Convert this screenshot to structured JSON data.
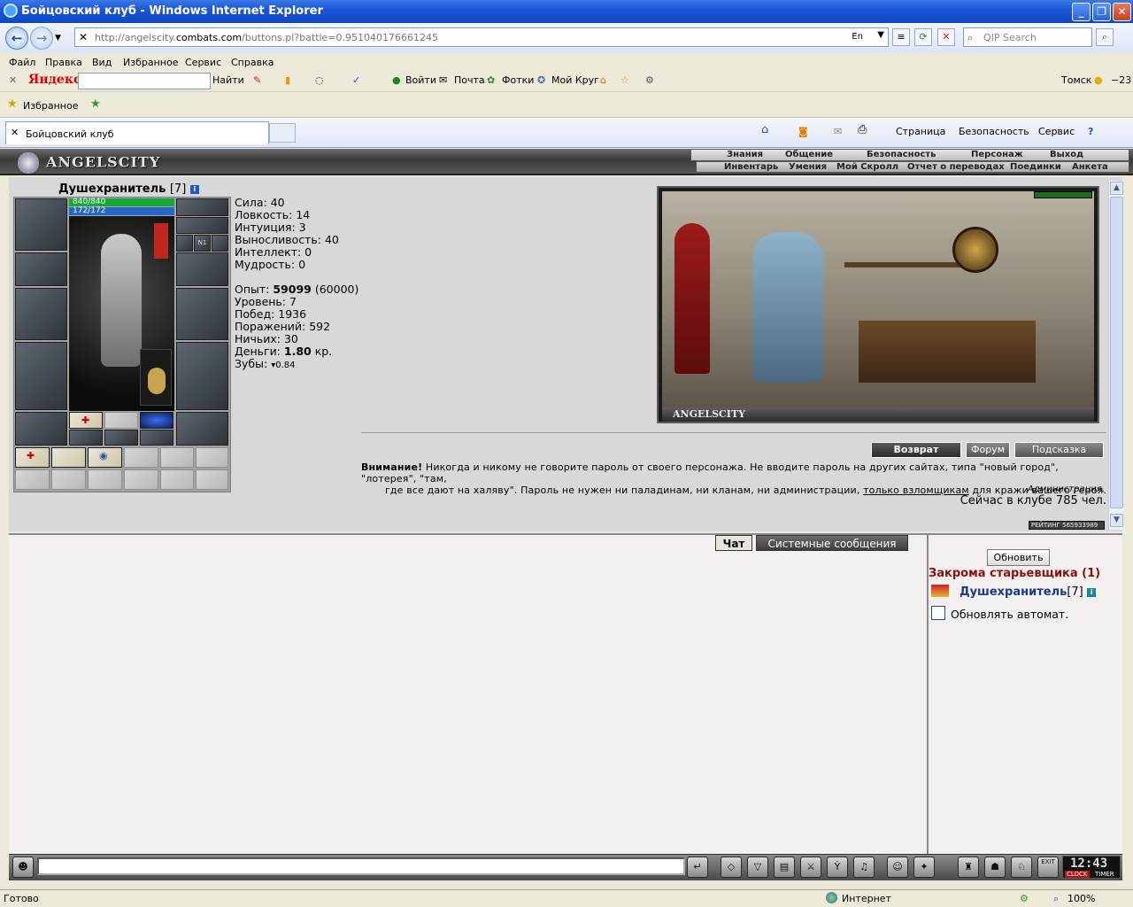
{
  "window": {
    "title": "Бойцовский клуб - Windows Internet Explorer",
    "url_prefix": "http://angelscity.",
    "url_domain": "combats.com",
    "url_suffix": "/buttons.pl?battle=0.951040176661245",
    "search_placeholder": "QIP Search",
    "lang_indicator": "En"
  },
  "menu": [
    "Файл",
    "Правка",
    "Вид",
    "Избранное",
    "Сервис",
    "Справка"
  ],
  "yandex_bar": {
    "brand": "Яндекс",
    "find": "Найти",
    "login": "Войти",
    "mail": "Почта",
    "photos": "Фотки",
    "circle": "Мой Круг",
    "city": "Томск",
    "temp": "−23"
  },
  "favorites_bar": {
    "favorites": "Избранное"
  },
  "tabs": {
    "active": "Бойцовский клуб"
  },
  "command_bar": [
    "Страница",
    "Безопасность",
    "Сервис"
  ],
  "game": {
    "logo": "ANGELSCITY",
    "top_menu": [
      "Знания",
      "Общение",
      "Безопасность",
      "Персонаж",
      "Выход"
    ],
    "sub_menu": [
      "Инвентарь",
      "Умения",
      "Мой Скролл",
      "Отчет о переводах",
      "Поединки",
      "Анкета"
    ],
    "character": {
      "name": "Душехранитель",
      "level": "[7]",
      "hp": "840/840",
      "mana": "172/172",
      "slot_label": "N1"
    },
    "stats": {
      "strength": "Сила: 40",
      "agility": "Ловкость: 14",
      "intuition": "Интуиция: 3",
      "endurance": "Выносливость: 40",
      "intellect": "Интеллект: 0",
      "wisdom": "Мудрость: 0",
      "exp_label": "Опыт: ",
      "exp_value": "59099",
      "exp_next": " (60000)",
      "level": "Уровень: 7",
      "wins": "Побед: 1936",
      "losses": "Поражений: 592",
      "draws": "Ничьих: 30",
      "money_label": "Деньги: ",
      "money_value": "1.80",
      "money_unit": " кр.",
      "teeth_label": "Зубы: ",
      "teeth_value": "0.84"
    },
    "scene_caption": "ANGELSCITY",
    "buttons": {
      "back": "Возврат",
      "forum": "Форум",
      "hint": "Подсказка"
    },
    "warning": {
      "title": "Внимание!",
      "line1": " Никогда и никому не говорите пароль от своего персонажа. Не вводите пароль на других сайтах, типа \"новый город\", \"лотерея\", \"там,",
      "line2_a": "где все дают на халяву\". Пароль не нужен ни паладинам, ни кланам, ни администрации, ",
      "line2_link": "только взломщикам",
      "line2_b": " для кражи вашего героя.",
      "admin": "Администрация."
    },
    "online": "Сейчас в клубе 785 чел.",
    "counter": "РЕЙТИНГ 565933989",
    "chat_tabs": {
      "chat": "Чат",
      "system": "Системные сообщения"
    },
    "side": {
      "refresh": "Обновить",
      "location": "Закрома старьевщика (1)",
      "player_name": "Душехранитель",
      "player_level": "[7]",
      "auto_refresh": "Обновлять автомат."
    },
    "clock": {
      "time": "12:43",
      "label1": "CLOCK",
      "label2": "TIMER"
    },
    "bottom_exit": "EXIT"
  },
  "status": {
    "left": "Готово",
    "zone": "Интернет",
    "zoom": "100%"
  }
}
